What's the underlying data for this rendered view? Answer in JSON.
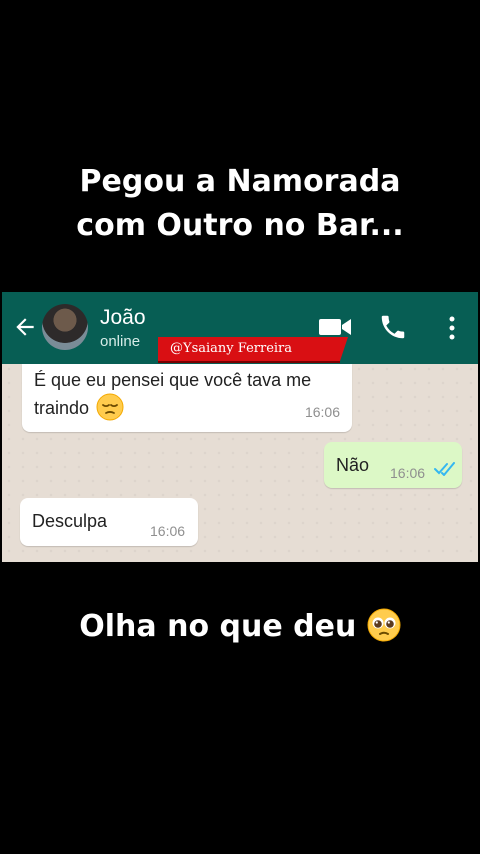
{
  "caption": {
    "line1": "Pegou a Namorada",
    "line2": "com Outro no Bar...",
    "bottom": "Olha no que deu",
    "bottom_emoji": "pleading-face-emoji"
  },
  "chat": {
    "contact_name": "João",
    "contact_status": "online",
    "watermark": "@Ysaiany Ferreira",
    "messages": [
      {
        "text": "É que eu pensei que você tava me traindo",
        "emoji": "pensive-face-emoji",
        "time": "16:06",
        "direction": "incoming"
      },
      {
        "text": "Não",
        "time": "16:06",
        "direction": "outgoing",
        "status": "read"
      },
      {
        "text": "Desculpa",
        "time": "16:06",
        "direction": "incoming"
      }
    ],
    "icons": {
      "back": "back-arrow-icon",
      "video": "video-call-icon",
      "call": "phone-call-icon",
      "menu": "more-options-icon"
    },
    "colors": {
      "header": "#075e54",
      "incoming": "#ffffff",
      "outgoing": "#dcf8c6",
      "background": "#e6ddd4",
      "read_ticks": "#34b7f1",
      "watermark": "#d90f13"
    }
  }
}
